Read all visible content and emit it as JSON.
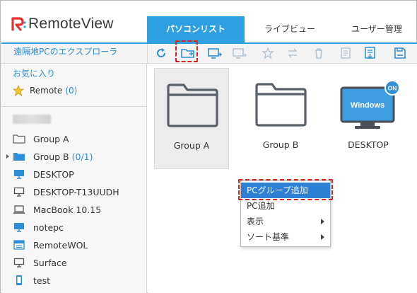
{
  "app": {
    "logo_text": "RemoteView",
    "accent_color": "#2e9fe0",
    "highlight_color": "#d6241c"
  },
  "tabs": [
    {
      "label": "パソコンリスト",
      "active": true
    },
    {
      "label": "ライブビュー",
      "active": false
    },
    {
      "label": "ユーザー管理",
      "active": false
    }
  ],
  "explorer": {
    "title": "遠隔地PCのエクスプローラ"
  },
  "toolbar": {
    "buttons": [
      "refresh-icon",
      "add-folder-icon",
      "add-pc-icon",
      "move-pc-icon",
      "favorite-icon",
      "swap-icon",
      "delete-icon",
      "memo-icon",
      "export-icon",
      "save-icon"
    ]
  },
  "sidebar": {
    "favorites_label": "お気に入り",
    "favorite_item": {
      "label": "Remote",
      "count": "(0)"
    },
    "tree": [
      {
        "label": "Group A",
        "count": "",
        "icon": "folder-outline-icon"
      },
      {
        "label": "Group B",
        "count": "(0/1)",
        "icon": "folder-filled-icon"
      },
      {
        "label": "DESKTOP",
        "count": "",
        "icon": "monitor-on-icon"
      },
      {
        "label": "DESKTOP-T13UUDH",
        "count": "",
        "icon": "monitor-off-icon"
      },
      {
        "label": "MacBook 10.15",
        "count": "",
        "icon": "laptop-icon"
      },
      {
        "label": "notepc",
        "count": "",
        "icon": "monitor-on-icon"
      },
      {
        "label": "RemoteWOL",
        "count": "",
        "icon": "wol-icon"
      },
      {
        "label": "Surface",
        "count": "",
        "icon": "monitor-off-icon"
      },
      {
        "label": "test",
        "count": "",
        "icon": "mobile-icon"
      }
    ]
  },
  "main": {
    "tiles": [
      {
        "label": "Group A",
        "type": "folder"
      },
      {
        "label": "Group B",
        "type": "folder"
      },
      {
        "label": "DESKTOP",
        "type": "pc",
        "screen_text": "Windows",
        "badge": "ON"
      }
    ]
  },
  "context_menu": {
    "items": [
      {
        "label": "PCグループ追加",
        "highlighted": true,
        "submenu": false
      },
      {
        "label": "PC追加",
        "highlighted": false,
        "submenu": false
      },
      {
        "label": "表示",
        "highlighted": false,
        "submenu": true
      },
      {
        "label": "ソート基準",
        "highlighted": false,
        "submenu": true
      }
    ]
  }
}
